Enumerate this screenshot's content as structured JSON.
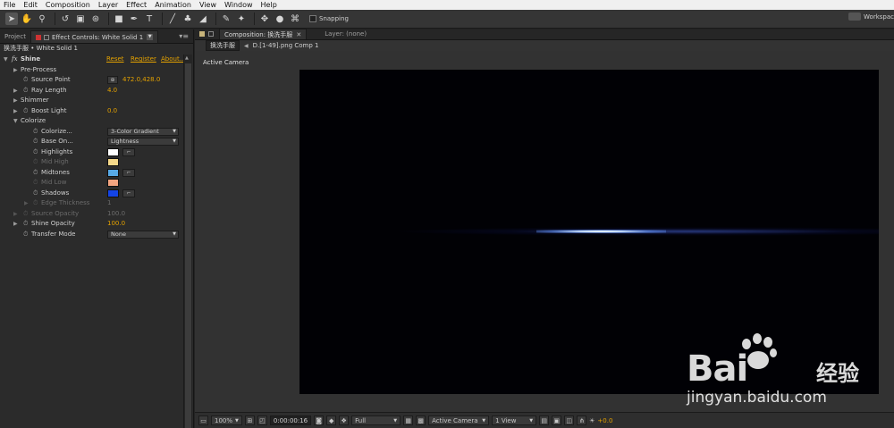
{
  "menubar": {
    "items": [
      "File",
      "Edit",
      "Composition",
      "Layer",
      "Effect",
      "Animation",
      "View",
      "Window",
      "Help"
    ]
  },
  "toolbar": {
    "snapping_label": "Snapping",
    "workspace_label": "Workspac"
  },
  "left_panel": {
    "tab_project": "Project",
    "tab_effect_controls": "Effect Controls: White Solid 1",
    "menu_glyph": "▾≡",
    "header": "换洗手服 • White Solid 1",
    "effect_name": "Shine",
    "fx_label": "fx",
    "reset": "Reset",
    "register": "Register",
    "about": "About...",
    "properties": {
      "pre_process": "Pre-Process",
      "source_point": "Source Point",
      "source_point_value": "472.0,428.0",
      "ray_length": "Ray Length",
      "ray_length_value": "4.0",
      "shimmer": "Shimmer",
      "boost_light": "Boost Light",
      "boost_light_value": "0.0",
      "colorize_group": "Colorize",
      "colorize_param": "Colorize...",
      "colorize_value": "3-Color Gradient",
      "base_on": "Base On...",
      "base_on_value": "Lightness",
      "highlights": "Highlights",
      "mid_high": "Mid High",
      "midtones": "Midtones",
      "mid_low": "Mid Low",
      "shadows": "Shadows",
      "edge_thickness": "Edge Thickness",
      "edge_thickness_value": "1",
      "source_opacity": "Source Opacity",
      "source_opacity_value": "100.0",
      "shine_opacity": "Shine Opacity",
      "shine_opacity_value": "100.0",
      "transfer_mode": "Transfer Mode",
      "transfer_mode_value": "None"
    },
    "colors": {
      "highlights": "#ffffff",
      "mid_high": "#f6d98a",
      "midtones": "#57a9e6",
      "mid_low": "#f3a580",
      "shadows": "#1444e6"
    }
  },
  "composition_panel": {
    "tab_composition": "Composition: 换洗手服",
    "tab_layer": "Layer: (none)",
    "flow_current": "换洗手服",
    "flow_next": "D.[1-49].png Comp 1",
    "active_camera": "Active Camera"
  },
  "viewer_bar": {
    "zoom": "100%",
    "timecode": "0:00:00:16",
    "resolution": "Full",
    "camera": "Active Camera",
    "views": "1 View",
    "exposure": "+0.0"
  },
  "watermark": {
    "brand": "Bai",
    "brand_tail": "经验",
    "url": "jingyan.baidu.com"
  }
}
